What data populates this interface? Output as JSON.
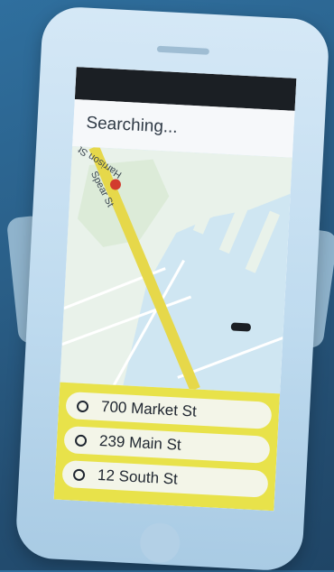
{
  "app": {
    "header_text": "Searching..."
  },
  "map": {
    "street_label_main": "Spear St",
    "street_label_cross": "Harrison St",
    "street_label_side": "St"
  },
  "locations": [
    {
      "label": "700 Market St"
    },
    {
      "label": "239 Main St"
    },
    {
      "label": "12 South St"
    }
  ],
  "colors": {
    "route": "#e6d84a",
    "panel": "#e8e24a",
    "water": "#cfe6f2",
    "land": "#e9f2ea",
    "pin": "#d23b2e"
  }
}
